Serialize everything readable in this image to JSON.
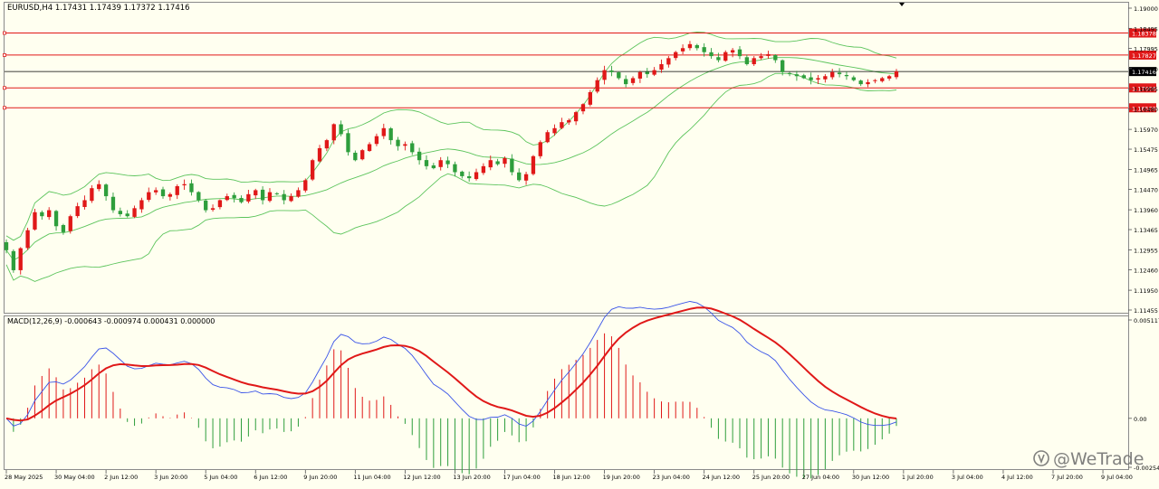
{
  "header": {
    "symbol_line": "EURUSD,H4  1.17431 1.17439 1.17372 1.17416"
  },
  "indicator": {
    "label": "MACD(12,26,9) -0.000643 -0.000974 0.000431 0.000000"
  },
  "watermark": {
    "text": "@WeTrade",
    "icon": "wetrade-logo-icon"
  },
  "colors": {
    "background": "#fffff0",
    "bull": "#2e9e3c",
    "bear": "#e01818",
    "band": "#5cc45c",
    "level_line": "#e01818",
    "current_line": "#000000",
    "macd_line": "#3a54e8",
    "signal_line": "#e01818",
    "hist_pos": "#e01818",
    "hist_neg": "#2e9e3c"
  },
  "chart_data": [
    {
      "type": "candlestick",
      "title": "",
      "ylim": [
        1.11455,
        1.19
      ],
      "yticks": [
        "1.19000",
        "1.18495",
        "1.17995",
        "1.17490",
        "1.16985",
        "1.16480",
        "1.15970",
        "1.15475",
        "1.14965",
        "1.14470",
        "1.13960",
        "1.13465",
        "1.12955",
        "1.12460",
        "1.11950",
        "1.11455"
      ],
      "x_labels": [
        "28 May 2025",
        "30 May 04:00",
        "2 Jun 12:00",
        "3 Jun 20:00",
        "5 Jun 04:00",
        "6 Jun 12:00",
        "9 Jun 20:00",
        "11 Jun 04:00",
        "12 Jun 12:00",
        "13 Jun 20:00",
        "17 Jun 04:00",
        "18 Jun 12:00",
        "19 Jun 20:00",
        "23 Jun 04:00",
        "24 Jun 12:00",
        "25 Jun 20:00",
        "27 Jun 04:00",
        "30 Jun 12:00",
        "1 Jul 20:00",
        "3 Jul 04:00",
        "4 Jul 12:00",
        "7 Jul 20:00",
        "9 Jul 04:00"
      ],
      "x_label_index": [
        0,
        7,
        14,
        21,
        28,
        35,
        42,
        49,
        56,
        63,
        70,
        77,
        84,
        91,
        98,
        105,
        112,
        119,
        126,
        133,
        140,
        147,
        154
      ],
      "close_path": [
        1.1295,
        1.1245,
        1.13,
        1.1345,
        1.139,
        1.138,
        1.1395,
        1.1355,
        1.134,
        1.138,
        1.1405,
        1.142,
        1.145,
        1.146,
        1.143,
        1.1395,
        1.1385,
        1.138,
        1.14,
        1.142,
        1.144,
        1.1445,
        1.143,
        1.1435,
        1.1455,
        1.146,
        1.144,
        1.142,
        1.1395,
        1.14,
        1.142,
        1.143,
        1.1425,
        1.1415,
        1.1435,
        1.1445,
        1.142,
        1.144,
        1.1435,
        1.142,
        1.143,
        1.1445,
        1.147,
        1.152,
        1.155,
        1.157,
        1.161,
        1.1585,
        1.154,
        1.152,
        1.1545,
        1.156,
        1.158,
        1.16,
        1.157,
        1.1555,
        1.156,
        1.154,
        1.152,
        1.1505,
        1.15,
        1.152,
        1.151,
        1.149,
        1.148,
        1.1475,
        1.149,
        1.1505,
        1.152,
        1.151,
        1.1525,
        1.149,
        1.147,
        1.1485,
        1.153,
        1.1565,
        1.159,
        1.16,
        1.1615,
        1.162,
        1.164,
        1.166,
        1.169,
        1.172,
        1.1745,
        1.174,
        1.1725,
        1.171,
        1.1725,
        1.174,
        1.1735,
        1.1745,
        1.176,
        1.1775,
        1.179,
        1.18,
        1.181,
        1.18,
        1.179,
        1.178,
        1.177,
        1.179,
        1.1795,
        1.178,
        1.176,
        1.1775,
        1.178,
        1.1785,
        1.177,
        1.174,
        1.1735,
        1.173,
        1.1725,
        1.172,
        1.1725,
        1.173,
        1.174,
        1.1735,
        1.173,
        1.172,
        1.171,
        1.1715,
        1.172,
        1.1725,
        1.173,
        1.1742
      ],
      "bollinger": {
        "period": 20,
        "deviations": 2
      },
      "horizontal_levels": [
        {
          "value": 1.18378,
          "label": "1.18378"
        },
        {
          "value": 1.17827,
          "label": "1.17827"
        },
        {
          "value": 1.17006,
          "label": "1.17006"
        },
        {
          "value": 1.16509,
          "label": "1.16509"
        }
      ],
      "current_price": {
        "value": 1.17416,
        "label": "1.17416"
      }
    },
    {
      "type": "macd",
      "name": "MACD(12,26,9)",
      "ylim": [
        -0.002548,
        0.005117
      ],
      "yticks": [
        "0.005117",
        "0.00",
        "-0.002548"
      ],
      "params": [
        12,
        26,
        9
      ]
    }
  ]
}
